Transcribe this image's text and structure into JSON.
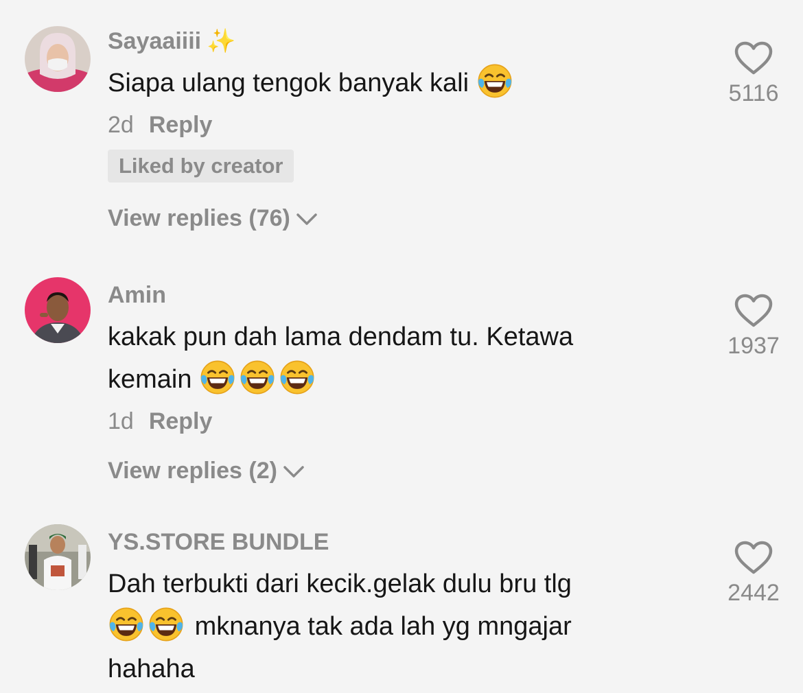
{
  "comments": [
    {
      "username": "Sayaaiiii",
      "username_emoji": "✨",
      "text": "Siapa ulang tengok banyak kali",
      "text_emojis": [
        "😂"
      ],
      "time": "2d",
      "reply_label": "Reply",
      "badge": "Liked by creator",
      "view_replies": "View replies (76)",
      "likes": "5116"
    },
    {
      "username": "Amin",
      "text_line1": "kakak pun dah lama dendam tu. Ketawa",
      "text_line2": "kemain",
      "text_emojis": [
        "😂",
        "😂",
        "😂"
      ],
      "time": "1d",
      "reply_label": "Reply",
      "view_replies": "View replies (2)",
      "likes": "1937"
    },
    {
      "username": "YS.STORE BUNDLE",
      "text_line1": "Dah terbukti dari kecik.gelak dulu bru tlg",
      "text_line2": "mknanya tak ada lah yg mngajar",
      "text_line3": "hahaha",
      "text_emojis": [
        "😂",
        "😂"
      ],
      "likes": "2442"
    }
  ],
  "colors": {
    "background": "#f4f4f4",
    "primary_text": "#161616",
    "secondary_text": "#8a8a8a",
    "badge_bg": "#e6e6e6"
  },
  "icons": {
    "like": "heart-outline-icon",
    "expand": "chevron-down-icon",
    "laugh_emoji": "face-with-tears-of-joy"
  }
}
